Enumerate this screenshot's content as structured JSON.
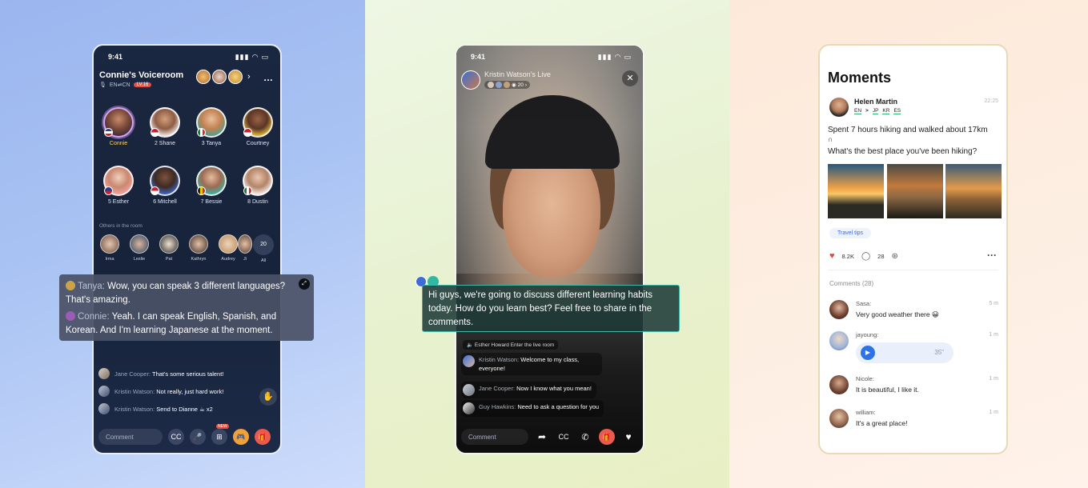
{
  "voiceroom": {
    "status_time": "9:41",
    "title": "Connie's Voiceroom",
    "lang_pair": "EN⇌CN",
    "level_badge": "LV.16",
    "top_more": "…",
    "seats": [
      {
        "name": "Connie"
      },
      {
        "name": "2 Shane"
      },
      {
        "name": "3 Tanya"
      },
      {
        "name": "Courtney"
      },
      {
        "name": "5 Esther"
      },
      {
        "name": "6 Mitchell"
      },
      {
        "name": "7 Bessie"
      },
      {
        "name": "8 Dustin"
      }
    ],
    "others_label": "Others in the room",
    "others": [
      {
        "name": "Irma"
      },
      {
        "name": "Leslie"
      },
      {
        "name": "Pat"
      },
      {
        "name": "Kathryn"
      },
      {
        "name": "Audrey"
      },
      {
        "name": "Ji"
      }
    ],
    "others_count": "20",
    "others_all": "All",
    "overlay": {
      "line1_speaker": "Tanya:",
      "line1_text": "Wow, you can speak 3 different languages? That's amazing.",
      "line2_speaker": "Connie:",
      "line2_text": "Yeah. I can speak English, Spanish, and Korean. And I'm learning Japanese at the moment."
    },
    "chat": [
      {
        "who": "Jane Cooper:",
        "msg": "That's some serious talent!"
      },
      {
        "who": "Kristin Watson:",
        "msg": "Not really, just hard work!"
      },
      {
        "who": "Kristin Watson:",
        "msg": "Send to Dianne ☕ x2"
      }
    ],
    "comment_placeholder": "Comment",
    "new_badge": "NEW"
  },
  "live": {
    "status_time": "9:41",
    "title": "Kristin Watson's Live",
    "viewers": "20",
    "close": "✕",
    "overlay_text": "Hi guys, we're going to discuss different learning habits today. How do you learn best? Feel free to share in the comments.",
    "enter_text": "Esther Howard Enter the live room",
    "chat": [
      {
        "who": "Kristin Watson:",
        "msg": "Welcome to my class, everyone!"
      },
      {
        "who": "Jane Cooper:",
        "msg": "Now I know what you mean!"
      },
      {
        "who": "Guy Hawkins:",
        "msg": "Need to ask a question for you"
      }
    ],
    "comment_placeholder": "Comment"
  },
  "moments": {
    "title": "Moments",
    "post": {
      "author": "Helen Martin",
      "langs": [
        "EN",
        "JP",
        "KR",
        "ES"
      ],
      "lang_sep": ">",
      "time": "22:25",
      "text1": "Spent 7 hours hiking and walked about 17km",
      "emoji": "∩",
      "text2": "What's the best place you've been hiking?",
      "tag": "Travel tips",
      "likes": "8.2K",
      "comments": "28",
      "more": "···"
    },
    "comments_label": "Comments",
    "comments_count": "(28)",
    "comment_list": [
      {
        "name": "Sasa:",
        "text": "Very good weather there 😀",
        "time": "5 m"
      },
      {
        "name": "jayoung:",
        "voice_duration": "35\"",
        "time": "1 m"
      },
      {
        "name": "Nicole:",
        "text": "It is beautiful, I like it.",
        "time": "1 m"
      },
      {
        "name": "william:",
        "text": "It's a great place!",
        "time": "1 m"
      }
    ]
  },
  "colors": {
    "accent_blue": "#2e73e6",
    "like_red": "#e8433a",
    "translation_border": "#3eb7a5"
  }
}
